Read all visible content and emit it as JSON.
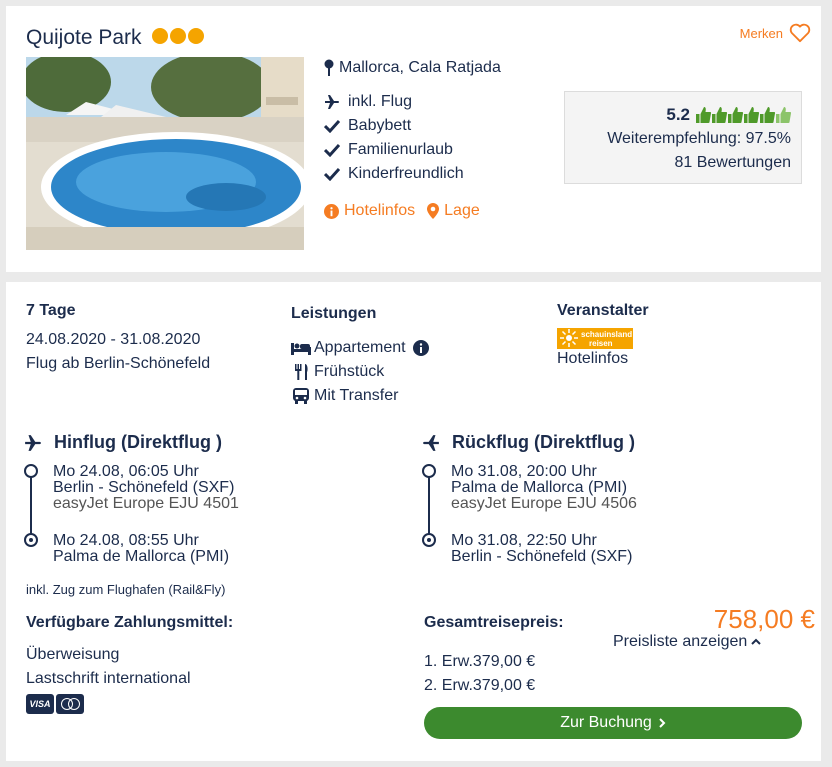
{
  "hotel": {
    "name": "Quijote Park",
    "star_count": 3,
    "location": "Mallorca, Cala Ratjada",
    "features": [
      "inkl. Flug",
      "Babybett",
      "Familienurlaub",
      "Kinderfreundlich"
    ],
    "feature_icons": [
      "plane-icon",
      "check-icon",
      "check-icon",
      "check-icon"
    ],
    "hotelinfos_link": "Hotelinfos",
    "lage_link": "Lage",
    "merken_label": "Merken"
  },
  "rating": {
    "score": "5.2",
    "recommendation": "Weiterempfehlung: 97.5%",
    "reviews": "81 Bewertungen",
    "thumbs_count": 6
  },
  "trip": {
    "duration": "7 Tage",
    "dates": "24.08.2020 - 31.08.2020",
    "departure": "Flug ab Berlin-Schönefeld"
  },
  "services": {
    "heading": "Leistungen",
    "items": [
      "Appartement",
      "Frühstück",
      "Mit Transfer"
    ]
  },
  "operator": {
    "heading": "Veranstalter",
    "logo_line1": "schauinsland",
    "logo_line2": "reisen",
    "link": "Hotelinfos"
  },
  "outbound": {
    "heading": "Hinflug (Direktflug )",
    "dep_time": "Mo 24.08, 06:05 Uhr",
    "dep_airport": "Berlin - Schönefeld (SXF)",
    "airline": "easyJet Europe EJU 4501",
    "arr_time": "Mo 24.08, 08:55 Uhr",
    "arr_airport": "Palma de Mallorca (PMI)"
  },
  "return": {
    "heading": "Rückflug (Direktflug )",
    "dep_time": "Mo 31.08, 20:00 Uhr",
    "dep_airport": "Palma de Mallorca (PMI)",
    "airline": "easyJet Europe EJU 4506",
    "arr_time": "Mo 31.08, 22:50 Uhr",
    "arr_airport": "Berlin - Schönefeld (SXF)"
  },
  "rail_note": "inkl. Zug zum Flughafen (Rail&Fly)",
  "payment": {
    "heading": "Verfügbare Zahlungsmittel:",
    "methods": [
      "Überweisung",
      "Lastschrift international"
    ],
    "visa": "VISA"
  },
  "pricing": {
    "heading": "Gesamtreisepreis:",
    "total": "758,00 €",
    "list_link": "Preisliste anzeigen",
    "lines": [
      "1. Erw.379,00 €",
      "2. Erw.379,00 €"
    ]
  },
  "booking_button": "Zur Buchung",
  "colors": {
    "accent": "#f57c22",
    "navy": "#1c2c4c",
    "green": "#3c8a2e",
    "star": "#f5a400",
    "thumb": "#4f9a2a"
  }
}
